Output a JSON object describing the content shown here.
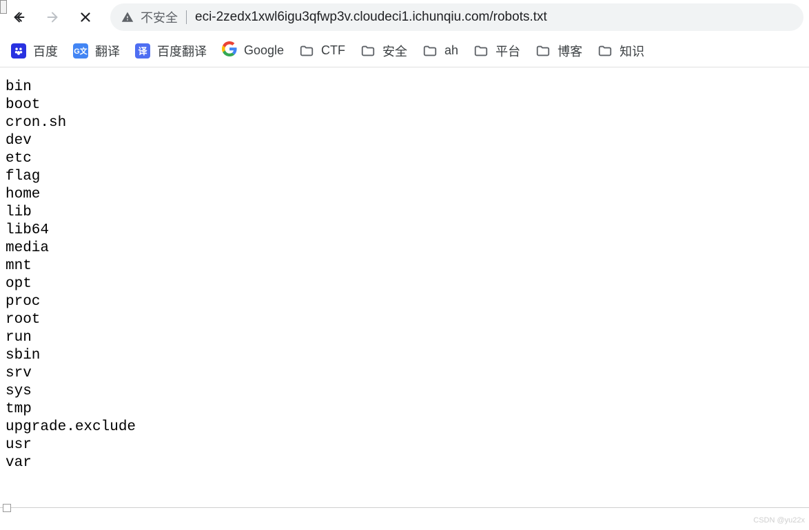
{
  "nav": {
    "back_label": "Back",
    "forward_label": "Forward",
    "stop_label": "Stop"
  },
  "omnibox": {
    "warning_label": "不安全",
    "url": "eci-2zedx1xwl6igu3qfwp3v.cloudeci1.ichunqiu.com/robots.txt"
  },
  "bookmarks": [
    {
      "label": "百度",
      "icon": "baidu",
      "color": "#2932e1"
    },
    {
      "label": "翻译",
      "icon": "gtranslate",
      "color": "#4285f4"
    },
    {
      "label": "百度翻译",
      "icon": "yi",
      "color": "#4e6ef2"
    },
    {
      "label": "Google",
      "icon": "google",
      "color": ""
    },
    {
      "label": "CTF",
      "icon": "folder",
      "color": ""
    },
    {
      "label": "安全",
      "icon": "folder",
      "color": ""
    },
    {
      "label": "ah",
      "icon": "folder",
      "color": ""
    },
    {
      "label": "平台",
      "icon": "folder",
      "color": ""
    },
    {
      "label": "博客",
      "icon": "folder",
      "color": ""
    },
    {
      "label": "知识",
      "icon": "folder",
      "color": ""
    }
  ],
  "page_body": "bin\nboot\ncron.sh\ndev\netc\nflag\nhome\nlib\nlib64\nmedia\nmnt\nopt\nproc\nroot\nrun\nsbin\nsrv\nsys\ntmp\nupgrade.exclude\nusr\nvar",
  "watermark": "CSDN @yu22x"
}
